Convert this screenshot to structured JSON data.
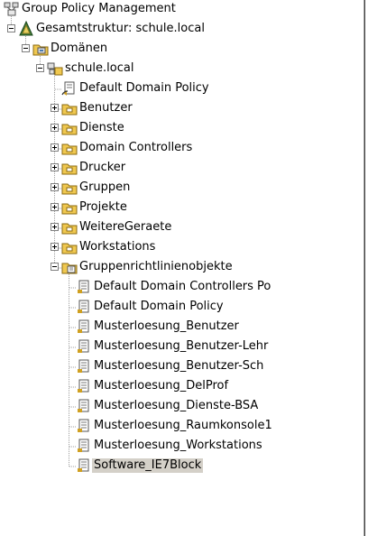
{
  "tree": {
    "root": {
      "label": "Group Policy Management",
      "icon": "gpmc-root-icon"
    },
    "forest": {
      "label": "Gesamtstruktur: schule.local",
      "icon": "forest-icon"
    },
    "domains_folder": {
      "label": "Domänen",
      "icon": "domains-folder-icon"
    },
    "domain": {
      "label": "schule.local",
      "icon": "domain-icon"
    },
    "domain_children": [
      {
        "label": "Default Domain Policy",
        "icon": "gpo-link-icon",
        "expandable": false
      },
      {
        "label": "Benutzer",
        "icon": "ou-folder-icon",
        "expandable": true
      },
      {
        "label": "Dienste",
        "icon": "ou-folder-icon",
        "expandable": true
      },
      {
        "label": "Domain Controllers",
        "icon": "ou-folder-icon",
        "expandable": true
      },
      {
        "label": "Drucker",
        "icon": "ou-folder-icon",
        "expandable": true
      },
      {
        "label": "Gruppen",
        "icon": "ou-folder-icon",
        "expandable": true
      },
      {
        "label": "Projekte",
        "icon": "ou-folder-icon",
        "expandable": true
      },
      {
        "label": "WeitereGeraete",
        "icon": "ou-folder-icon",
        "expandable": true
      },
      {
        "label": "Workstations",
        "icon": "ou-folder-icon",
        "expandable": true
      }
    ],
    "gpo_container": {
      "label": "Gruppenrichtlinienobjekte",
      "icon": "gpo-container-icon"
    },
    "gpos": [
      {
        "label": "Default Domain Controllers Po",
        "selected": false
      },
      {
        "label": "Default Domain Policy",
        "selected": false
      },
      {
        "label": "Musterloesung_Benutzer",
        "selected": false
      },
      {
        "label": "Musterloesung_Benutzer-Lehr",
        "selected": false
      },
      {
        "label": "Musterloesung_Benutzer-Sch",
        "selected": false
      },
      {
        "label": "Musterloesung_DelProf",
        "selected": false
      },
      {
        "label": "Musterloesung_Dienste-BSA",
        "selected": false
      },
      {
        "label": "Musterloesung_Raumkonsole1",
        "selected": false
      },
      {
        "label": "Musterloesung_Workstations",
        "selected": false
      },
      {
        "label": "Software_IE7Block",
        "selected": true
      }
    ],
    "colors": {
      "selection": "#d4d0c8",
      "line": "#a0a0a0",
      "box": "#7f7f7f"
    }
  }
}
